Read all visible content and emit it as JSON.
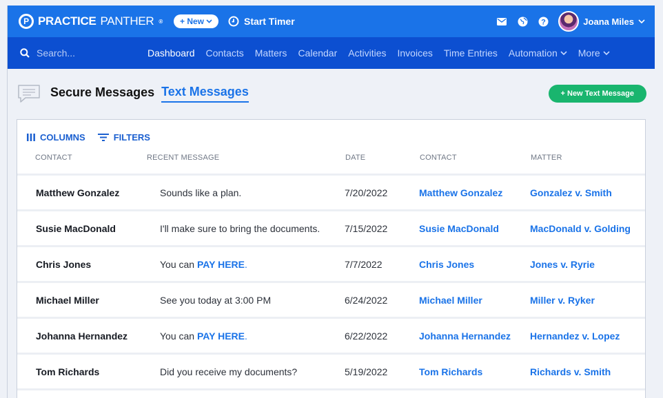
{
  "brand": {
    "name_bold": "PRACTICE",
    "name_light": "PANTHER",
    "mark": "P",
    "reg": "®"
  },
  "topbar": {
    "new_label": "+ New",
    "timer_label": "Start Timer",
    "user_name": "Joana Miles",
    "icons": [
      "mail-icon",
      "globe-icon",
      "help-icon"
    ]
  },
  "navbar": {
    "search_placeholder": "Search...",
    "items": [
      {
        "label": "Dashboard",
        "active": true
      },
      {
        "label": "Contacts"
      },
      {
        "label": "Matters"
      },
      {
        "label": "Calendar"
      },
      {
        "label": "Activities"
      },
      {
        "label": "Invoices"
      },
      {
        "label": "Time Entries"
      },
      {
        "label": "Automation",
        "dropdown": true
      },
      {
        "label": "More",
        "dropdown": true
      }
    ]
  },
  "header": {
    "tab_secure": "Secure Messages",
    "tab_text": "Text Messages",
    "new_button": "+ New Text Message"
  },
  "toolbar": {
    "columns": "COLUMNS",
    "filters": "FILTERS"
  },
  "table": {
    "headers": [
      "CONTACT",
      "RECENT MESSAGE",
      "DATE",
      "CONTACT",
      "MATTER"
    ],
    "rows": [
      {
        "contact": "Matthew Gonzalez",
        "message": "Sounds like a plan.",
        "date": "7/20/2022",
        "contact_link": "Matthew Gonzalez",
        "matter": "Gonzalez v. Smith"
      },
      {
        "contact": "Susie MacDonald",
        "message": "I'll make sure to bring the documents.",
        "date": "7/15/2022",
        "contact_link": "Susie MacDonald",
        "matter": "MacDonald v. Golding"
      },
      {
        "contact": "Chris Jones",
        "message": "You can ",
        "pay": "PAY HERE",
        "date": "7/7/2022",
        "contact_link": "Chris Jones",
        "matter": "Jones v. Ryrie"
      },
      {
        "contact": "Michael Miller",
        "message": "See you today at 3:00 PM",
        "date": "6/24/2022",
        "contact_link": "Michael Miller",
        "matter": "Miller v. Ryker"
      },
      {
        "contact": "Johanna Hernandez",
        "message": "You can ",
        "pay": "PAY HERE",
        "date": "6/22/2022",
        "contact_link": "Johanna Hernandez",
        "matter": "Hernandez v. Lopez"
      },
      {
        "contact": "Tom Richards",
        "message": "Did you receive my documents?",
        "date": "5/19/2022",
        "contact_link": "Tom Richards",
        "matter": "Richards v. Smith"
      }
    ]
  },
  "colors": {
    "top": "#1a73e8",
    "nav": "#0c4fd1",
    "accent": "#1a73e8",
    "green": "#19b56e"
  }
}
